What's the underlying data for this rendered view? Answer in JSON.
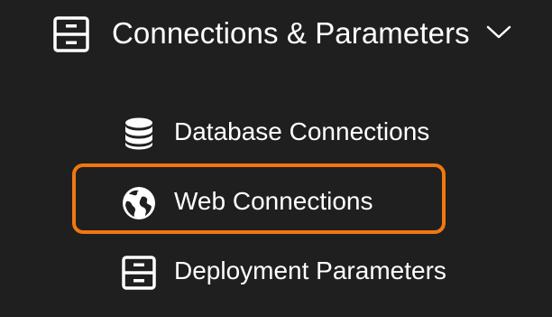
{
  "group": {
    "title": "Connections & Parameters",
    "icon": "drawer-icon",
    "expanded_icon": "chevron-down-icon"
  },
  "items": [
    {
      "label": "Database Connections",
      "icon": "database-icon",
      "active": false
    },
    {
      "label": "Web Connections",
      "icon": "globe-icon",
      "active": true
    },
    {
      "label": "Deployment Parameters",
      "icon": "drawer-icon",
      "active": false
    }
  ],
  "colors": {
    "background": "#1f1f1f",
    "text": "#ffffff",
    "active_outline": "#f0780f"
  }
}
